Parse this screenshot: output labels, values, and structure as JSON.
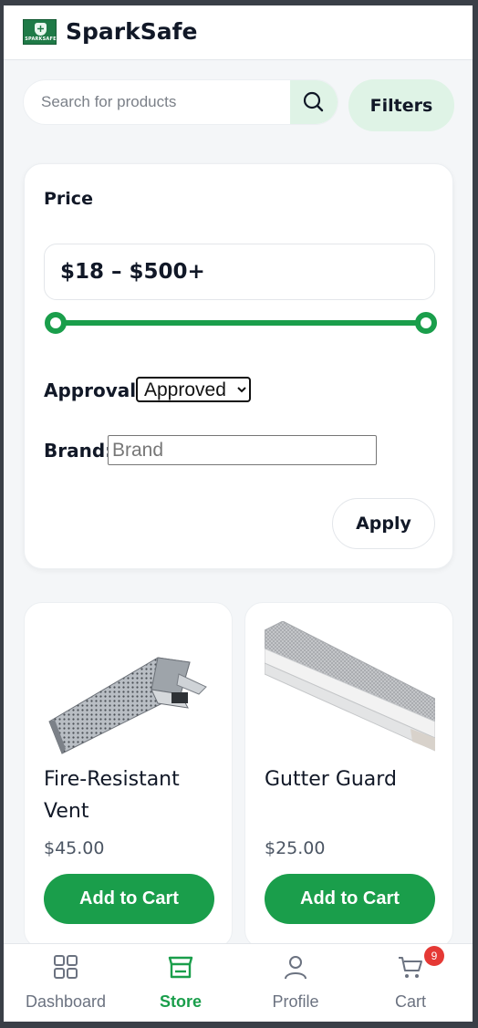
{
  "header": {
    "logo_text": "SPARKSAFE",
    "brand_name": "SparkSafe"
  },
  "search": {
    "placeholder": "Search for products",
    "value": ""
  },
  "filters_button_label": "Filters",
  "filter_panel": {
    "price_label": "Price",
    "price_range": "$18 – $500+",
    "price_min": 18,
    "price_max": 500,
    "approval_label": "Approval:",
    "approval_selected": "Approved",
    "brand_label": "Brand:",
    "brand_placeholder": "Brand",
    "brand_value": "",
    "apply_label": "Apply"
  },
  "products": [
    {
      "name": "Fire-Resistant Vent",
      "price": "$45.00",
      "button_label": "Add to Cart"
    },
    {
      "name": "Gutter Guard",
      "price": "$25.00",
      "button_label": "Add to Cart"
    }
  ],
  "bottom_nav": {
    "items": [
      {
        "label": "Dashboard",
        "icon": "grid-icon",
        "active": false
      },
      {
        "label": "Store",
        "icon": "store-icon",
        "active": true
      },
      {
        "label": "Profile",
        "icon": "user-icon",
        "active": false
      },
      {
        "label": "Cart",
        "icon": "cart-icon",
        "active": false
      }
    ],
    "cart_count": "9"
  },
  "colors": {
    "accent": "#1a9e4b",
    "accent_light": "#dff3e6",
    "badge": "#e53935",
    "background": "#f4f6f8"
  }
}
